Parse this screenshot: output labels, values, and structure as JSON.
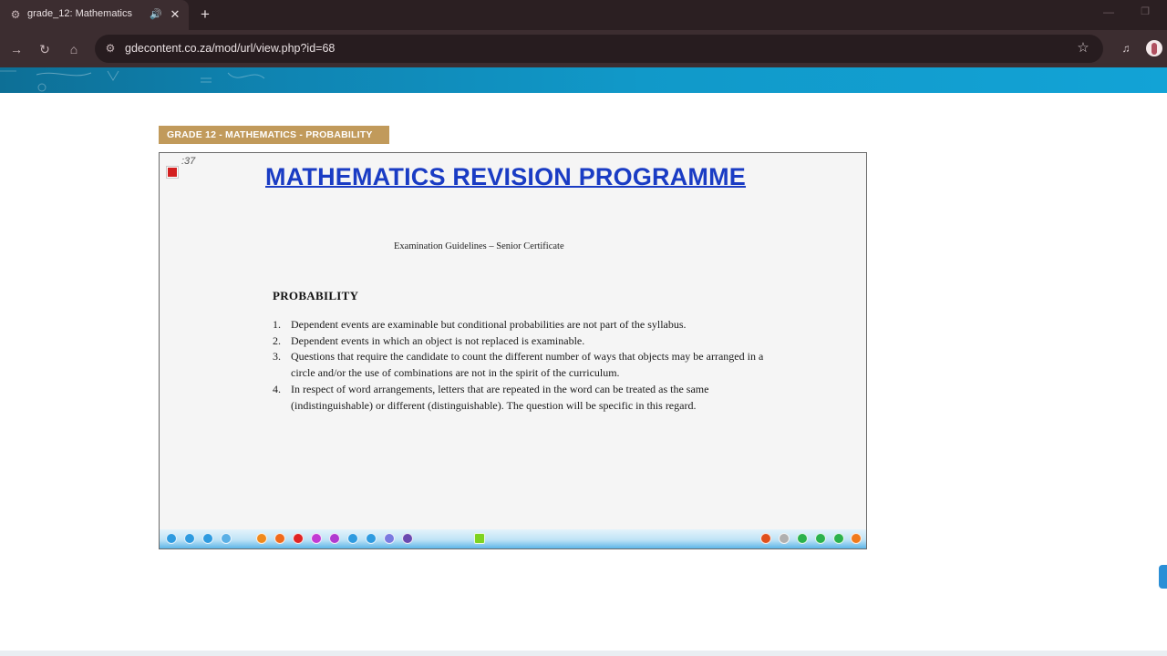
{
  "browser": {
    "tab_title": "grade_12: Mathematics",
    "icons": {
      "favicon": "moodle-icon",
      "audio": "speaker-icon",
      "close": "close-icon",
      "new_tab": "plus-icon",
      "back": "arrow-left-icon",
      "forward": "arrow-right-icon",
      "reload": "reload-icon",
      "home": "home-icon",
      "site_info": "tune-icon",
      "bookmark": "star-icon",
      "media": "media-controls-icon",
      "minimize": "minimize-icon",
      "maximize": "maximize-icon"
    },
    "url": "gdecontent.co.za/mod/url/view.php?id=68"
  },
  "page": {
    "course_tag": "GRADE 12 - MATHEMATICS - PROBABILITY",
    "viewer": {
      "timer": ":37",
      "title": "MATHEMATICS REVISION PROGRAMME",
      "subtitle": "Examination Guidelines – Senior Certificate",
      "heading": "PROBABILITY",
      "guidelines": [
        {
          "num": "1.",
          "text": "Dependent events are examinable but conditional probabilities are not part of the syllabus."
        },
        {
          "num": "2.",
          "text": "Dependent events in which an object is not replaced is examinable."
        },
        {
          "num": "3.",
          "text": "Questions that require the candidate to count the different number of ways that objects may be arranged in a circle and/or the use of combinations are not in the spirit of the curriculum."
        },
        {
          "num": "4.",
          "text": "In respect of word arrangements, letters that are repeated in the word can be treated as the same (indistinguishable) or different (distinguishable). The question will be specific in this regard."
        }
      ],
      "annotation_tools": [
        {
          "name": "select-tool-icon",
          "color": "#2e9be0"
        },
        {
          "name": "screen-tool-icon",
          "color": "#2e9be0"
        },
        {
          "name": "settings-tool-icon",
          "color": "#2e9be0"
        },
        {
          "name": "cloud-tool-icon",
          "color": "#5ab0e6"
        },
        {
          "name": "text-tool-icon",
          "color": "#f08a1c"
        },
        {
          "name": "pen-tool-icon",
          "color": "#f06a1c"
        },
        {
          "name": "marker-tool-icon",
          "color": "#e02424"
        },
        {
          "name": "highlighter-tool-icon",
          "color": "#c23bd4"
        },
        {
          "name": "shape-tool-icon",
          "color": "#b03ad0"
        },
        {
          "name": "hand-tool-icon",
          "color": "#2e9be0"
        },
        {
          "name": "type-tool-icon",
          "color": "#2e9be0"
        },
        {
          "name": "zoom-tool-icon",
          "color": "#7a7ae0"
        },
        {
          "name": "eraser-tool-icon",
          "color": "#6a4ab0"
        },
        {
          "name": "spotlight-tool-icon",
          "color": "#7ed321"
        },
        {
          "name": "undo-tool-icon",
          "color": "#e0501c"
        },
        {
          "name": "redo-tool-icon",
          "color": "#b0b0b0"
        },
        {
          "name": "prev-page-icon",
          "color": "#2bb24c"
        },
        {
          "name": "page-number-icon",
          "color": "#2bb24c"
        },
        {
          "name": "next-page-icon",
          "color": "#2bb24c"
        },
        {
          "name": "add-page-icon",
          "color": "#f07a1c"
        }
      ]
    }
  }
}
